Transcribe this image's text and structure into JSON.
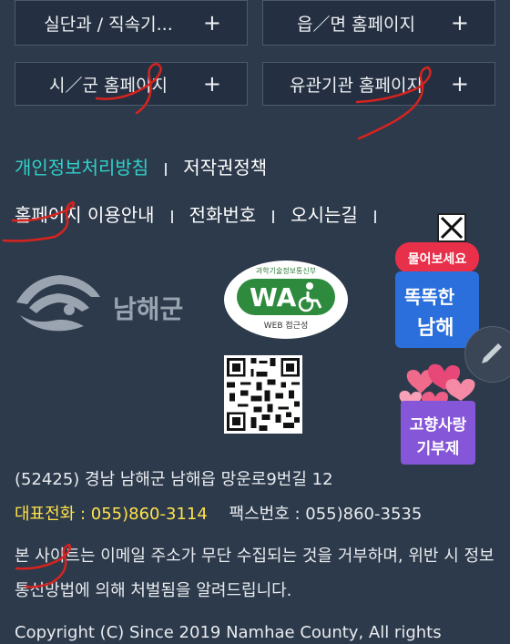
{
  "buttons": [
    {
      "label": "실단과 / 직속기...",
      "plus": "+"
    },
    {
      "label": "읍／면 홈페이지",
      "plus": "+"
    },
    {
      "label": "시／군 홈페이지",
      "plus": "+"
    },
    {
      "label": "유관기관 홈페이지",
      "plus": "+"
    }
  ],
  "footer_links_1": {
    "privacy": "개인정보처리방침",
    "copyright_policy": "저작권정책"
  },
  "footer_links_2": {
    "guide": "홈페이지 이용안내",
    "phone": "전화번호",
    "directions": "오시는길"
  },
  "logo": {
    "name": "남해군"
  },
  "wa_mark": {
    "top": "과학기술정보통신부",
    "mark": "WA",
    "bottom": "WEB 접근성"
  },
  "chat_badge": {
    "bubble": "물어보세요",
    "line1": "똑똑한",
    "line2": "남해"
  },
  "donation_badge": {
    "line1": "고향사랑",
    "line2": "기부제"
  },
  "address": "(52425) 경남 남해군 남해읍 망운로9번길 12",
  "contact": {
    "main_label": "대표전화",
    "main_value": " : 055)860-3114",
    "fax": "팩스번호 : 055)860-3535"
  },
  "notice": "본 사이트는 이메일 주소가 무단 수집되는 것을 거부하며, 위반 시 정보통신망법에 의해 처벌됨을 알려드립니다.",
  "copyright": "Copyright (C) Since 2019 Namhae County, All rights",
  "colors": {
    "background": "#2d3a4b",
    "accent_teal": "#2fd3c9",
    "accent_yellow": "#ffe24a",
    "annotation_red": "#d8231f"
  }
}
